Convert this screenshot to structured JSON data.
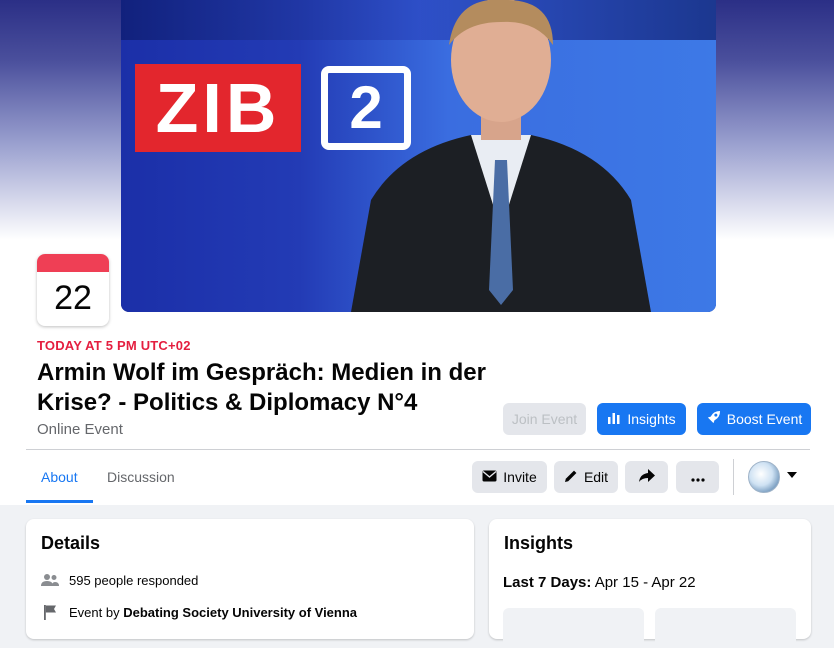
{
  "event": {
    "date_day": "22",
    "when": "TODAY AT 5 PM UTC+02",
    "title": "Armin Wolf im Gespräch: Medien in der Krise? - Politics & Diplomacy N°4",
    "location": "Online Event"
  },
  "cover": {
    "logo_text": "ZIB",
    "logo_number": "2"
  },
  "header_actions": {
    "join": "Join Event",
    "insights": "Insights",
    "boost": "Boost Event"
  },
  "tabs": [
    {
      "label": "About",
      "active": true
    },
    {
      "label": "Discussion",
      "active": false
    }
  ],
  "toolbar": {
    "invite": "Invite",
    "edit": "Edit"
  },
  "details": {
    "heading": "Details",
    "responded": "595 people responded",
    "event_by_prefix": "Event by ",
    "event_by_org": "Debating Society University of Vienna"
  },
  "insights_card": {
    "heading": "Insights",
    "range_label": "Last 7 Days:",
    "range_value": " Apr 15 - Apr 22"
  },
  "colors": {
    "accent": "#1877f2",
    "date_red": "#e41e3f",
    "badge_top": "#ef3f55"
  }
}
